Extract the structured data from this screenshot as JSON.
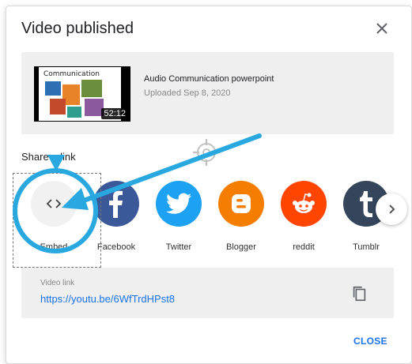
{
  "dialog": {
    "title": "Video published",
    "close_icon": "close-icon"
  },
  "video": {
    "thumbnail_title": "Communication",
    "duration": "52:12",
    "title": "Audio Communication powerpoint",
    "uploaded": "Uploaded Sep 8, 2020"
  },
  "share": {
    "label": "Share a link",
    "items": [
      {
        "label": "Embed",
        "icon": "embed-icon",
        "color": "#f1f1f1"
      },
      {
        "label": "Facebook",
        "icon": "facebook-icon",
        "color": "#3b5998"
      },
      {
        "label": "Twitter",
        "icon": "twitter-icon",
        "color": "#1da1f2"
      },
      {
        "label": "Blogger",
        "icon": "blogger-icon",
        "color": "#f57d00"
      },
      {
        "label": "reddit",
        "icon": "reddit-icon",
        "color": "#ff4500"
      },
      {
        "label": "Tumblr",
        "icon": "tumblr-icon",
        "color": "#35465c"
      }
    ]
  },
  "link": {
    "label": "Video link",
    "url": "https://youtu.be/6WfTrdHPst8"
  },
  "footer": {
    "close_label": "CLOSE"
  },
  "annotation": {
    "color": "#29a8e0"
  }
}
